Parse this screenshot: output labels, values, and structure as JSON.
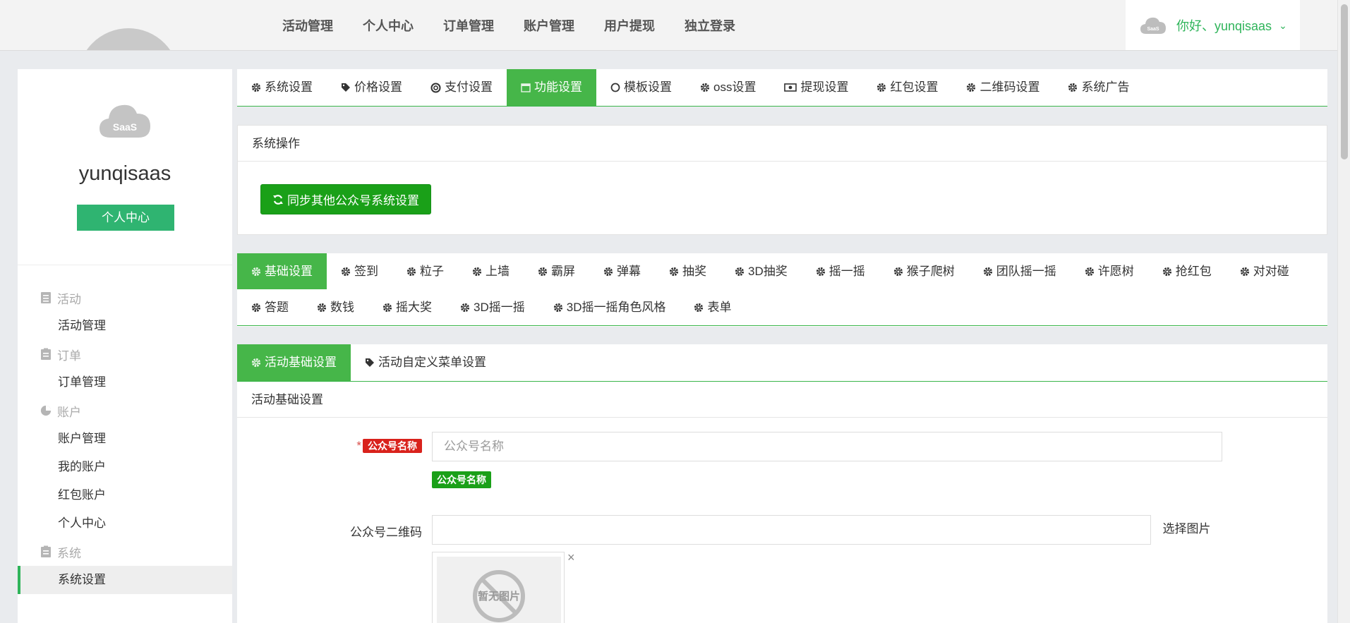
{
  "topnav": [
    "活动管理",
    "个人中心",
    "订单管理",
    "账户管理",
    "用户提现",
    "独立登录"
  ],
  "user": {
    "greeting": "你好、yunqisaas",
    "logo_text": "SaaS"
  },
  "sidebar": {
    "logo_text": "SaaS",
    "username": "yunqisaas",
    "profile_button": "个人中心",
    "groups": [
      {
        "label": "活动",
        "icon": "list-icon",
        "items": [
          "活动管理"
        ]
      },
      {
        "label": "订单",
        "icon": "clipboard-icon",
        "items": [
          "订单管理"
        ]
      },
      {
        "label": "账户",
        "icon": "pie-chart-icon",
        "items": [
          "账户管理",
          "我的账户",
          "红包账户",
          "个人中心"
        ]
      },
      {
        "label": "系统",
        "icon": "clipboard-icon",
        "items": [
          "系统设置"
        ]
      }
    ],
    "active_item": "系统设置"
  },
  "settings_tabs": {
    "active": "功能设置",
    "items": [
      {
        "label": "系统设置",
        "icon": "gear-icon"
      },
      {
        "label": "价格设置",
        "icon": "tag-icon"
      },
      {
        "label": "支付设置",
        "icon": "lifebuoy-icon"
      },
      {
        "label": "功能设置",
        "icon": "calendar-icon"
      },
      {
        "label": "模板设置",
        "icon": "circle-icon"
      },
      {
        "label": "oss设置",
        "icon": "gear-icon"
      },
      {
        "label": "提现设置",
        "icon": "money-icon"
      },
      {
        "label": "红包设置",
        "icon": "gear-icon"
      },
      {
        "label": "二维码设置",
        "icon": "gear-icon"
      },
      {
        "label": "系统广告",
        "icon": "gear-icon"
      }
    ]
  },
  "system_ops": {
    "title": "系统操作",
    "sync_button": "同步其他公众号系统设置"
  },
  "feature_tabs": {
    "active": "基础设置",
    "items": [
      "基础设置",
      "签到",
      "粒子",
      "上墙",
      "霸屏",
      "弹幕",
      "抽奖",
      "3D抽奖",
      "摇一摇",
      "猴子爬树",
      "团队摇一摇",
      "许愿树",
      "抢红包",
      "对对碰",
      "答题",
      "数钱",
      "摇大奖",
      "3D摇一摇",
      "3D摇一摇角色风格",
      "表单"
    ]
  },
  "activity_tabs": {
    "active": "活动基础设置",
    "items": [
      {
        "label": "活动基础设置",
        "icon": "gear-icon"
      },
      {
        "label": "活动自定义菜单设置",
        "icon": "tag-icon"
      }
    ]
  },
  "basic_form": {
    "title": "活动基础设置",
    "account_name_label": "公众号名称",
    "account_name_placeholder": "公众号名称",
    "account_name_hint": "公众号名称",
    "qrcode_label": "公众号二维码",
    "pick_image": "选择图片",
    "no_image": "暂无图片",
    "remove": "×"
  }
}
